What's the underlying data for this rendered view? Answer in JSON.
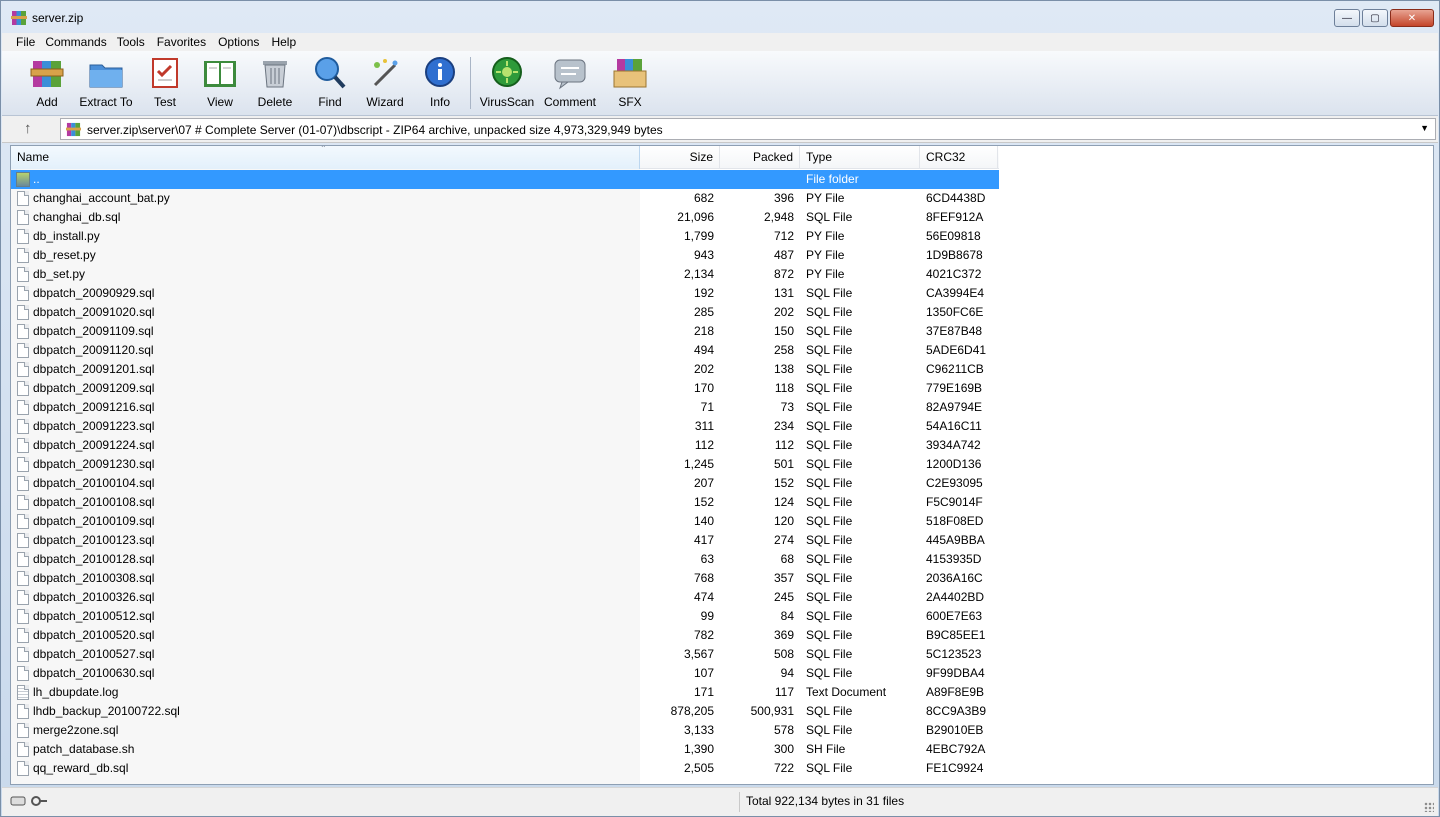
{
  "window": {
    "title": "server.zip",
    "controls": {
      "minimize": "—",
      "maximize": "▢",
      "close": "✕"
    }
  },
  "menu": [
    "File",
    "Commands",
    "Tools",
    "Favorites",
    "Options",
    "Help"
  ],
  "toolbar": [
    {
      "label": "Add",
      "icon": "add-archive-icon"
    },
    {
      "label": "Extract To",
      "icon": "extract-folder-icon"
    },
    {
      "label": "Test",
      "icon": "test-checklist-icon"
    },
    {
      "label": "View",
      "icon": "view-book-icon"
    },
    {
      "label": "Delete",
      "icon": "trash-can-icon"
    },
    {
      "label": "Find",
      "icon": "magnifier-icon"
    },
    {
      "label": "Wizard",
      "icon": "wizard-wand-icon"
    },
    {
      "label": "Info",
      "icon": "info-icon"
    },
    {
      "label": "VirusScan",
      "icon": "virus-scan-icon"
    },
    {
      "label": "Comment",
      "icon": "comment-icon"
    },
    {
      "label": "SFX",
      "icon": "sfx-box-icon"
    }
  ],
  "address": {
    "up_icon": "↑",
    "path": "server.zip\\server\\07 # Complete Server (01-07)\\dbscript - ZIP64 archive, unpacked size 4,973,329,949 bytes",
    "dropdown": "▼"
  },
  "columns": {
    "name": "Name",
    "size": "Size",
    "packed": "Packed",
    "type": "Type",
    "crc": "CRC32",
    "sort_indicator": "⌃"
  },
  "rows": [
    {
      "name": "..",
      "size": "",
      "packed": "",
      "type": "File folder",
      "crc": "",
      "kind": "up",
      "selected": true
    },
    {
      "name": "changhai_account_bat.py",
      "size": "682",
      "packed": "396",
      "type": "PY File",
      "crc": "6CD4438D",
      "kind": "file"
    },
    {
      "name": "changhai_db.sql",
      "size": "21,096",
      "packed": "2,948",
      "type": "SQL File",
      "crc": "8FEF912A",
      "kind": "file"
    },
    {
      "name": "db_install.py",
      "size": "1,799",
      "packed": "712",
      "type": "PY File",
      "crc": "56E09818",
      "kind": "file"
    },
    {
      "name": "db_reset.py",
      "size": "943",
      "packed": "487",
      "type": "PY File",
      "crc": "1D9B8678",
      "kind": "file"
    },
    {
      "name": "db_set.py",
      "size": "2,134",
      "packed": "872",
      "type": "PY File",
      "crc": "4021C372",
      "kind": "file"
    },
    {
      "name": "dbpatch_20090929.sql",
      "size": "192",
      "packed": "131",
      "type": "SQL File",
      "crc": "CA3994E4",
      "kind": "file"
    },
    {
      "name": "dbpatch_20091020.sql",
      "size": "285",
      "packed": "202",
      "type": "SQL File",
      "crc": "1350FC6E",
      "kind": "file"
    },
    {
      "name": "dbpatch_20091109.sql",
      "size": "218",
      "packed": "150",
      "type": "SQL File",
      "crc": "37E87B48",
      "kind": "file"
    },
    {
      "name": "dbpatch_20091120.sql",
      "size": "494",
      "packed": "258",
      "type": "SQL File",
      "crc": "5ADE6D41",
      "kind": "file"
    },
    {
      "name": "dbpatch_20091201.sql",
      "size": "202",
      "packed": "138",
      "type": "SQL File",
      "crc": "C96211CB",
      "kind": "file"
    },
    {
      "name": "dbpatch_20091209.sql",
      "size": "170",
      "packed": "118",
      "type": "SQL File",
      "crc": "779E169B",
      "kind": "file"
    },
    {
      "name": "dbpatch_20091216.sql",
      "size": "71",
      "packed": "73",
      "type": "SQL File",
      "crc": "82A9794E",
      "kind": "file"
    },
    {
      "name": "dbpatch_20091223.sql",
      "size": "311",
      "packed": "234",
      "type": "SQL File",
      "crc": "54A16C11",
      "kind": "file"
    },
    {
      "name": "dbpatch_20091224.sql",
      "size": "112",
      "packed": "112",
      "type": "SQL File",
      "crc": "3934A742",
      "kind": "file"
    },
    {
      "name": "dbpatch_20091230.sql",
      "size": "1,245",
      "packed": "501",
      "type": "SQL File",
      "crc": "1200D136",
      "kind": "file"
    },
    {
      "name": "dbpatch_20100104.sql",
      "size": "207",
      "packed": "152",
      "type": "SQL File",
      "crc": "C2E93095",
      "kind": "file"
    },
    {
      "name": "dbpatch_20100108.sql",
      "size": "152",
      "packed": "124",
      "type": "SQL File",
      "crc": "F5C9014F",
      "kind": "file"
    },
    {
      "name": "dbpatch_20100109.sql",
      "size": "140",
      "packed": "120",
      "type": "SQL File",
      "crc": "518F08ED",
      "kind": "file"
    },
    {
      "name": "dbpatch_20100123.sql",
      "size": "417",
      "packed": "274",
      "type": "SQL File",
      "crc": "445A9BBA",
      "kind": "file"
    },
    {
      "name": "dbpatch_20100128.sql",
      "size": "63",
      "packed": "68",
      "type": "SQL File",
      "crc": "4153935D",
      "kind": "file"
    },
    {
      "name": "dbpatch_20100308.sql",
      "size": "768",
      "packed": "357",
      "type": "SQL File",
      "crc": "2036A16C",
      "kind": "file"
    },
    {
      "name": "dbpatch_20100326.sql",
      "size": "474",
      "packed": "245",
      "type": "SQL File",
      "crc": "2A4402BD",
      "kind": "file"
    },
    {
      "name": "dbpatch_20100512.sql",
      "size": "99",
      "packed": "84",
      "type": "SQL File",
      "crc": "600E7E63",
      "kind": "file"
    },
    {
      "name": "dbpatch_20100520.sql",
      "size": "782",
      "packed": "369",
      "type": "SQL File",
      "crc": "B9C85EE1",
      "kind": "file"
    },
    {
      "name": "dbpatch_20100527.sql",
      "size": "3,567",
      "packed": "508",
      "type": "SQL File",
      "crc": "5C123523",
      "kind": "file"
    },
    {
      "name": "dbpatch_20100630.sql",
      "size": "107",
      "packed": "94",
      "type": "SQL File",
      "crc": "9F99DBA4",
      "kind": "file"
    },
    {
      "name": "lh_dbupdate.log",
      "size": "171",
      "packed": "117",
      "type": "Text Document",
      "crc": "A89F8E9B",
      "kind": "log"
    },
    {
      "name": "lhdb_backup_20100722.sql",
      "size": "878,205",
      "packed": "500,931",
      "type": "SQL File",
      "crc": "8CC9A3B9",
      "kind": "file"
    },
    {
      "name": "merge2zone.sql",
      "size": "3,133",
      "packed": "578",
      "type": "SQL File",
      "crc": "B29010EB",
      "kind": "file"
    },
    {
      "name": "patch_database.sh",
      "size": "1,390",
      "packed": "300",
      "type": "SH File",
      "crc": "4EBC792A",
      "kind": "file"
    },
    {
      "name": "qq_reward_db.sql",
      "size": "2,505",
      "packed": "722",
      "type": "SQL File",
      "crc": "FE1C9924",
      "kind": "file"
    }
  ],
  "status": {
    "text": "Total 922,134 bytes in 31 files"
  },
  "colors": {
    "selection": "#3399ff",
    "chrome": "#dfe9f5",
    "toolbar": "#e8edf4"
  }
}
